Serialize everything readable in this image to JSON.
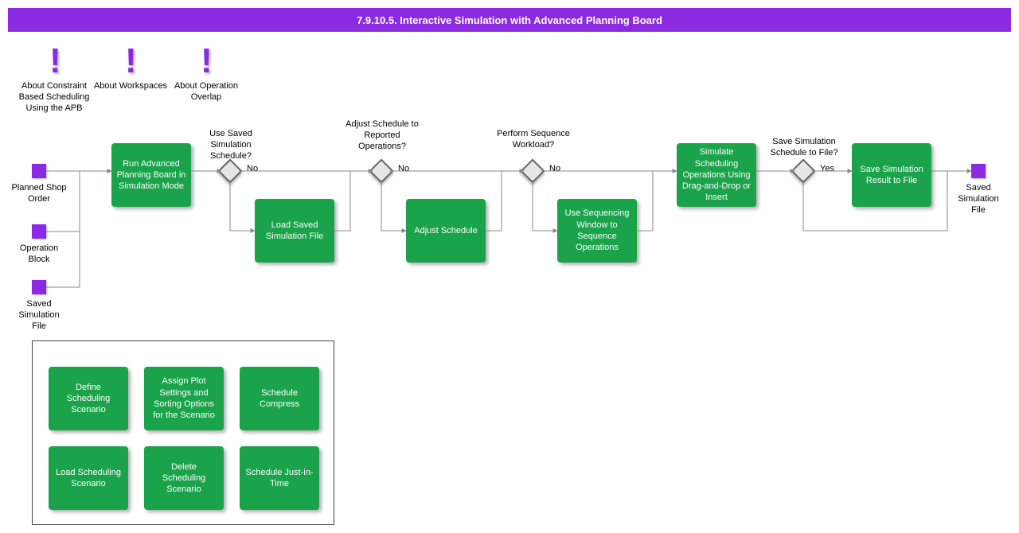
{
  "title": "7.9.10.5. Interactive Simulation with Advanced Planning Board",
  "about": [
    {
      "label": "About Constraint Based Scheduling Using the APB"
    },
    {
      "label": "About Workspaces"
    },
    {
      "label": "About Operation Overlap"
    }
  ],
  "inputs": [
    {
      "label": "Planned Shop Order"
    },
    {
      "label": "Operation Block"
    },
    {
      "label": "Saved Simulation File"
    }
  ],
  "processes": {
    "runAPB": "Run Advanced Planning Board in Simulation Mode",
    "loadSaved": "Load Saved Simulation File",
    "adjust": "Adjust Schedule",
    "sequence": "Use Sequencing Window to Sequence Operations",
    "dragDrop": "Simulate Scheduling Operations Using Drag-and-Drop or Insert",
    "saveResult": "Save Simulation Result to File"
  },
  "decisions": {
    "useSaved": {
      "q": "Use Saved Simulation Schedule?",
      "branch": "No"
    },
    "adjustRpt": {
      "q": "Adjust Schedule to Reported Operations?",
      "branch": "No"
    },
    "perform": {
      "q": "Perform Sequence Workload?",
      "branch": "No"
    },
    "saveFile": {
      "q": "Save Simulation Schedule to File?",
      "branch": "Yes"
    }
  },
  "output": {
    "label": "Saved Simulation File"
  },
  "subgroup": [
    "Define Scheduling Scenario",
    "Assign Plot Settings and Sorting Options for the Scenario",
    "Schedule Compress",
    "Load Scheduling Scenario",
    "Delete Scheduling Scenario",
    "Schedule Just-in-Time"
  ]
}
